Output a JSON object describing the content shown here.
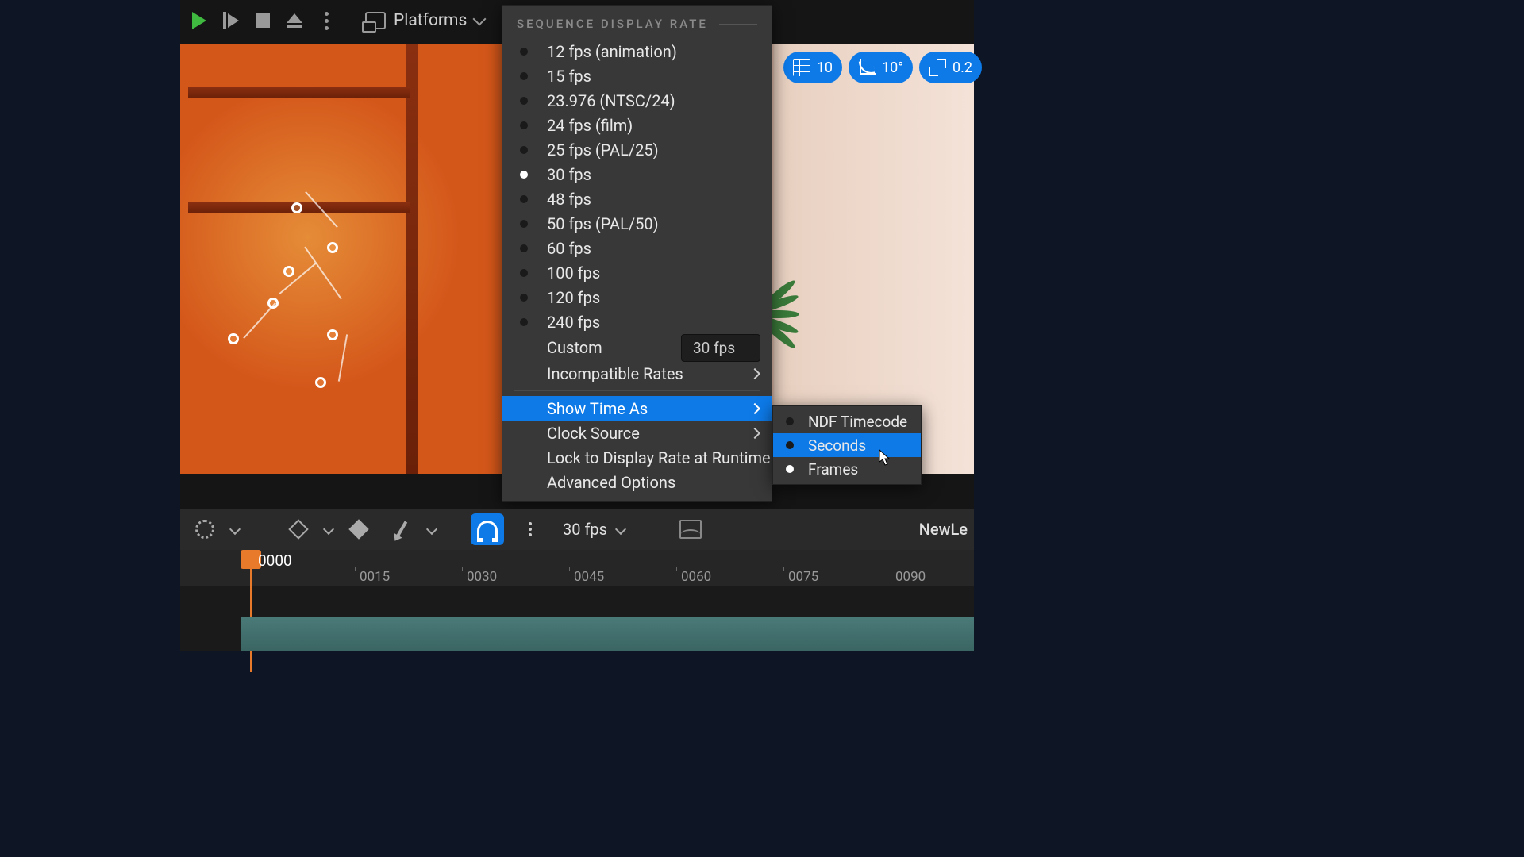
{
  "toolbar": {
    "platforms_label": "Platforms"
  },
  "viewport_overlay": {
    "grid_value": "10",
    "angle_value": "10°",
    "scale_value": "0.2"
  },
  "menu": {
    "header": "SEQUENCE DISPLAY RATE",
    "rates": [
      {
        "label": "12 fps (animation)",
        "selected": false
      },
      {
        "label": "15 fps",
        "selected": false
      },
      {
        "label": "23.976 (NTSC/24)",
        "selected": false
      },
      {
        "label": "24 fps (film)",
        "selected": false
      },
      {
        "label": "25 fps (PAL/25)",
        "selected": false
      },
      {
        "label": "30 fps",
        "selected": true
      },
      {
        "label": "48 fps",
        "selected": false
      },
      {
        "label": "50 fps (PAL/50)",
        "selected": false
      },
      {
        "label": "60 fps",
        "selected": false
      },
      {
        "label": "100 fps",
        "selected": false
      },
      {
        "label": "120 fps",
        "selected": false
      },
      {
        "label": "240 fps",
        "selected": false
      }
    ],
    "custom_label": "Custom",
    "custom_value": "30 fps",
    "incompatible_label": "Incompatible Rates",
    "show_time_as": "Show Time As",
    "clock_source": "Clock Source",
    "lock_label": "Lock to Display Rate at Runtime",
    "advanced_label": "Advanced Options"
  },
  "submenu": {
    "items": [
      {
        "label": "NDF Timecode",
        "selected": false,
        "highlight": false
      },
      {
        "label": "Seconds",
        "selected": false,
        "highlight": true
      },
      {
        "label": "Frames",
        "selected": true,
        "highlight": false
      }
    ]
  },
  "sequencer": {
    "fps_display": "30 fps",
    "title": "NewLe"
  },
  "timeline": {
    "playhead": "0000",
    "ticks": [
      "0015",
      "0030",
      "0045",
      "0060",
      "0075",
      "0090"
    ]
  }
}
